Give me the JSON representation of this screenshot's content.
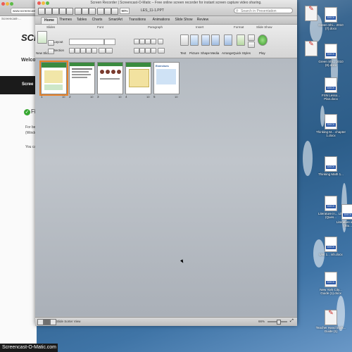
{
  "browser": {
    "url": "www.screencast",
    "bookmarks": "Screencast-...",
    "logo": "SCR",
    "welcome": "Welco",
    "banner": "Scree",
    "feature_heading": "Fi",
    "paragraphs": [
      "For be",
      "(Windo",
      "You ca"
    ]
  },
  "ppt": {
    "recorder_title": "Screen Recorder | Screencast-O-Matic – Free online screen recorder for instant screen capture video sharing.",
    "doc_title": "LES_11-1.PPT",
    "zoom_value": "90%",
    "search_placeholder": "Search in Presentation",
    "tabs": [
      "Home",
      "Themes",
      "Tables",
      "Charts",
      "SmartArt",
      "Transitions",
      "Animations",
      "Slide Show",
      "Review"
    ],
    "ribbon_groups": [
      "Slides",
      "Font",
      "Paragraph",
      "Insert",
      "Format",
      "Slide Show"
    ],
    "ribbon_buttons": {
      "new_slide": "New Slide",
      "layout": "Layout",
      "section": "Section",
      "text": "Text",
      "picture": "Picture",
      "shape": "Shape",
      "media": "Media",
      "arrange": "Arrange",
      "quick_styles": "Quick Styles",
      "play": "Play"
    },
    "slides": [
      {
        "number": "1",
        "count": "10"
      },
      {
        "number": "2",
        "count": "10"
      },
      {
        "number": "3",
        "count": "10"
      },
      {
        "number": "4",
        "count": "10"
      },
      {
        "number": "5",
        "count": "10"
      }
    ],
    "slide5_title": "Exercises",
    "status_view": "Slide Sorter View",
    "status_zoom": "66%"
  },
  "desktop_icons": [
    {
      "label": "",
      "type": "pdf"
    },
    {
      "label": "Green Shi... 2010 (7).docx",
      "type": "docx"
    },
    {
      "label": "",
      "type": "pdf"
    },
    {
      "label": "Green Shi... 2010 (8).docx",
      "type": "docx"
    },
    {
      "label": "FSN Lesso... Plan.docx",
      "type": "docx"
    },
    {
      "label": "Thinking M... chapter 1.docx",
      "type": "docx"
    },
    {
      "label": "Thinking Math 1...",
      "type": "docx"
    },
    {
      "label": "Literature in... Life (Ques...",
      "type": "docx"
    },
    {
      "label": "Literature in Life (Stu...",
      "type": "docx"
    },
    {
      "label": "Unit 1... ish.docx",
      "type": "docx"
    },
    {
      "label": "New York City... Guide (1).docx",
      "type": "docx"
    },
    {
      "label": "Teacher Hand book... Guide (1)",
      "type": "pdf"
    }
  ],
  "watermark": "Screencast-O-Matic.com",
  "colors": {
    "selection": "#e8832a",
    "docx_tag": "#2f5aa8",
    "pdf_red": "#c8211c"
  }
}
